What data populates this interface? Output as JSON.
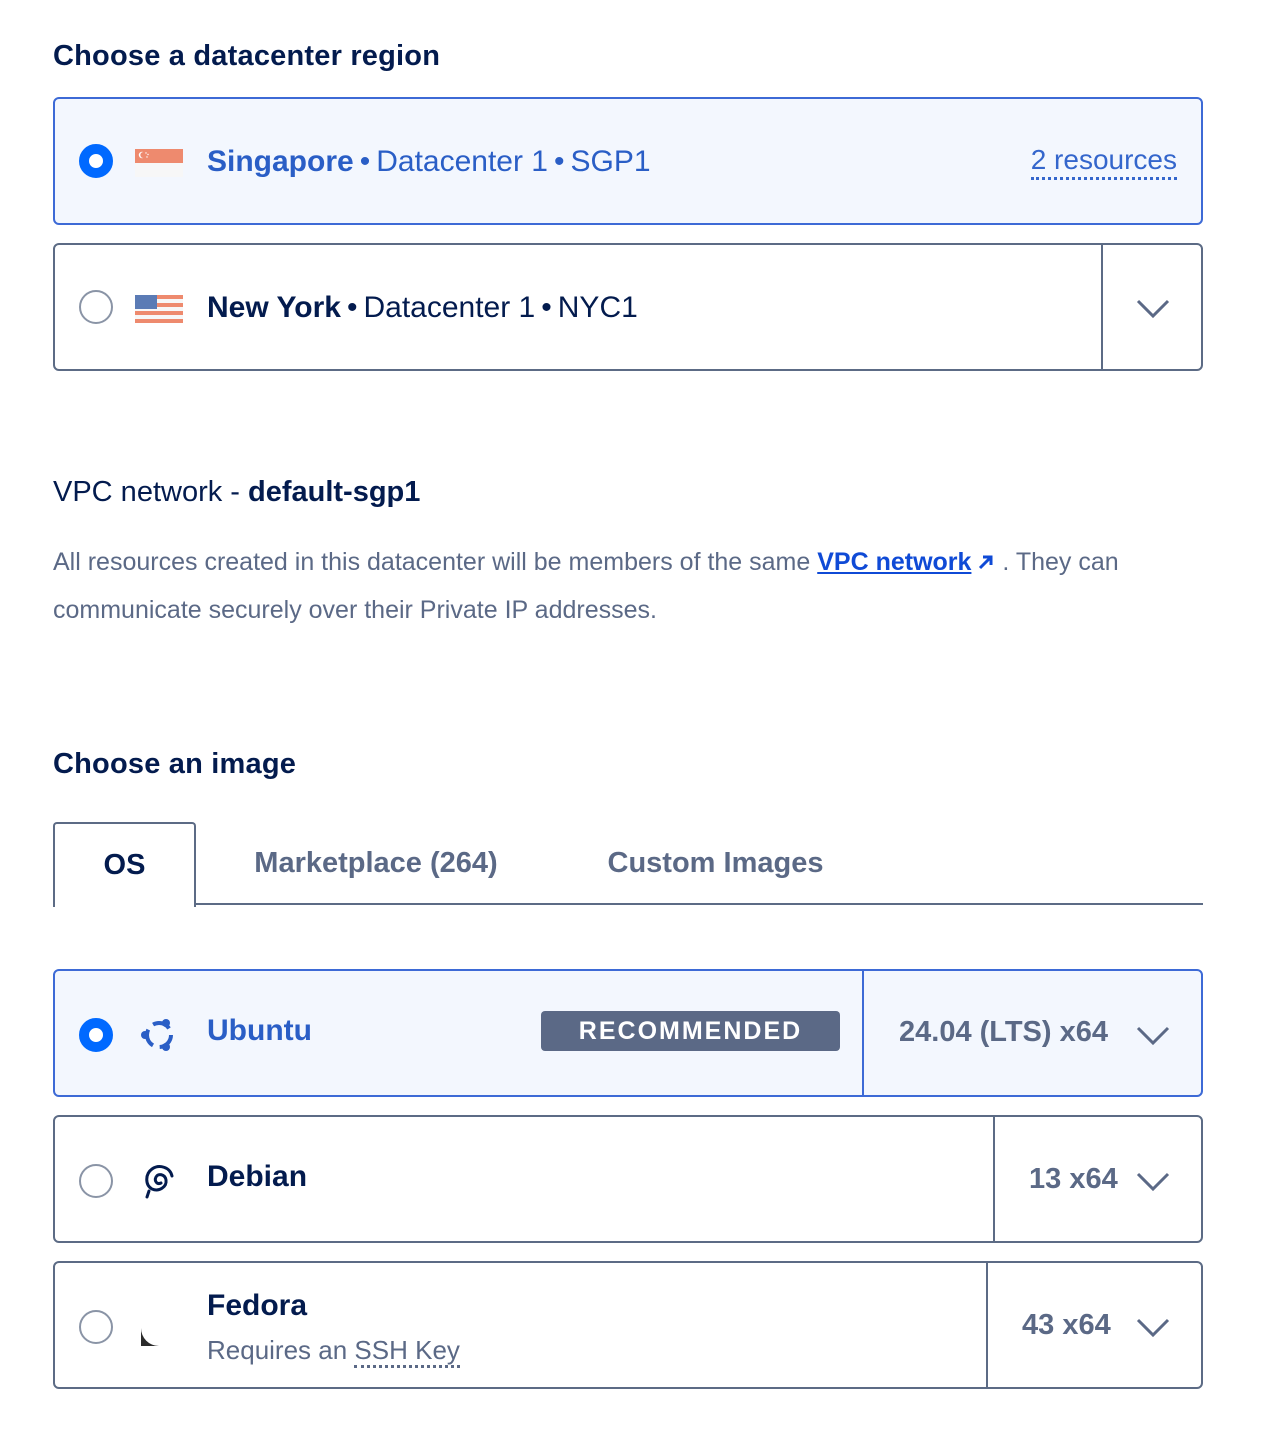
{
  "region_section": {
    "title": "Choose a datacenter region",
    "regions": [
      {
        "city": "Singapore",
        "datacenter": "Datacenter 1",
        "code": "SGP1",
        "resources": "2 resources",
        "selected": true,
        "flag": "singapore-flag-icon"
      },
      {
        "city": "New York",
        "datacenter": "Datacenter 1",
        "code": "NYC1",
        "selected": false,
        "flag": "usa-flag-icon"
      }
    ],
    "separator": "•"
  },
  "vpc": {
    "label": "VPC network - ",
    "name": "default-sgp1",
    "desc_before": "All resources created in this datacenter will be members of the same ",
    "link": "VPC network",
    "desc_after": " . They can communicate securely over their Private IP addresses."
  },
  "image_section": {
    "title": "Choose an image",
    "tabs": [
      "OS",
      "Marketplace (264)",
      "Custom Images"
    ],
    "active_tab": "OS",
    "images": [
      {
        "name": "Ubuntu",
        "badge": "RECOMMENDED",
        "version": "24.04 (LTS) x64",
        "selected": true,
        "icon": "ubuntu-icon"
      },
      {
        "name": "Debian",
        "version": "13 x64",
        "selected": false,
        "icon": "debian-icon"
      },
      {
        "name": "Fedora",
        "sub_prefix": "Requires an ",
        "sub_link": "SSH Key",
        "version": "43 x64",
        "selected": false,
        "icon": "fedora-icon"
      }
    ]
  },
  "colors": {
    "accent": "#0069ff",
    "selected_text": "#2a5ec6",
    "selected_bg": "#f3f7fe",
    "border": "#5c6b85",
    "muted": "#5b6986",
    "heading": "#031b4e"
  }
}
